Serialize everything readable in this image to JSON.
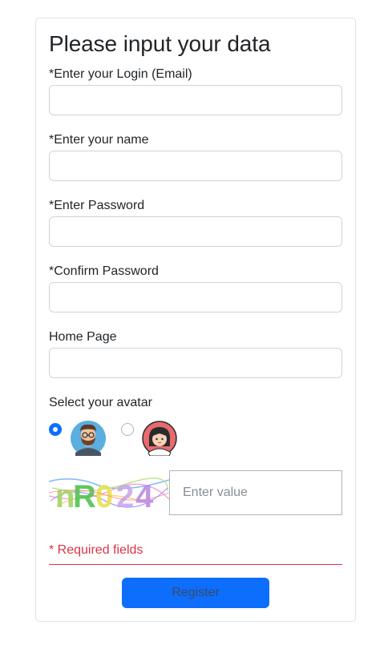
{
  "form": {
    "title": "Please input your data",
    "fields": [
      {
        "label": "*Enter your Login (Email)",
        "value": "",
        "placeholder": ""
      },
      {
        "label": "*Enter your name",
        "value": "",
        "placeholder": ""
      },
      {
        "label": "*Enter Password",
        "value": "",
        "placeholder": ""
      },
      {
        "label": "*Confirm Password",
        "value": "",
        "placeholder": ""
      },
      {
        "label": "Home Page",
        "value": "",
        "placeholder": ""
      }
    ],
    "avatar": {
      "label": "Select your avatar",
      "options": [
        {
          "icon": "man-with-beard-glasses-icon",
          "selected": true
        },
        {
          "icon": "girl-with-bangs-icon",
          "selected": false
        }
      ]
    },
    "captcha": {
      "image_text": "nR024",
      "placeholder": "Enter value",
      "value": ""
    },
    "required_note": "* Required fields",
    "register_label": "Register"
  },
  "colors": {
    "accent": "#0d6efd",
    "danger": "#dc3545",
    "border": "#ced4da"
  }
}
